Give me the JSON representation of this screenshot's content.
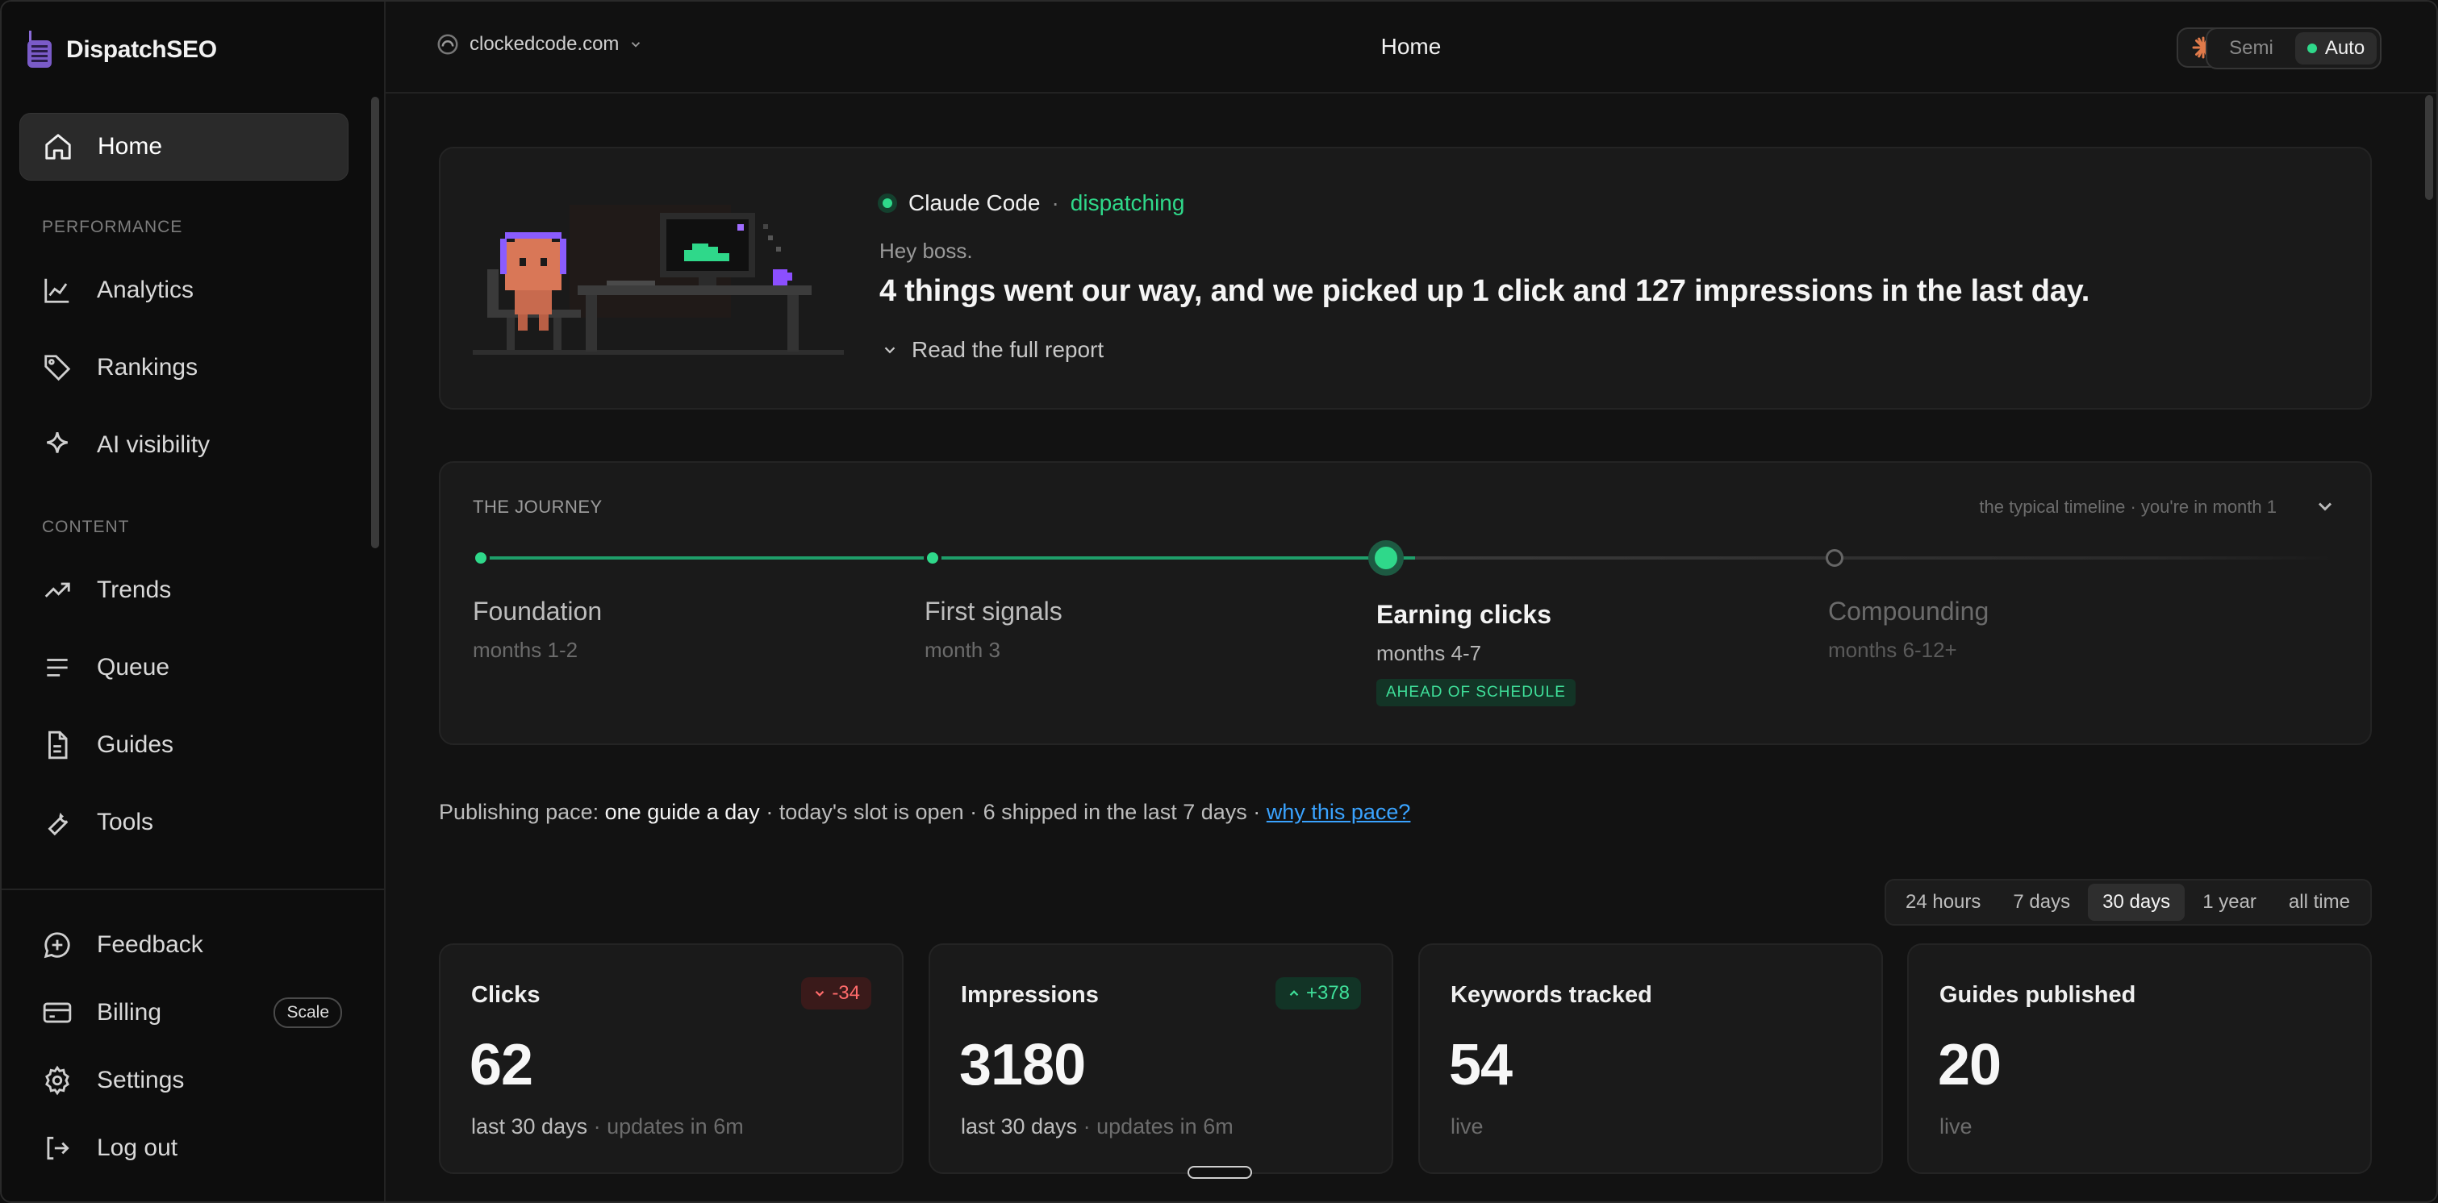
{
  "brand": {
    "name": "DispatchSEO"
  },
  "sidebar": {
    "home": "Home",
    "section_performance": "PERFORMANCE",
    "performance_items": [
      "Analytics",
      "Rankings",
      "AI visibility"
    ],
    "section_content": "CONTENT",
    "content_items": [
      "Trends",
      "Queue",
      "Guides",
      "Tools"
    ],
    "bottom_items": [
      "Feedback",
      "Billing",
      "Settings",
      "Log out"
    ],
    "billing_plan": "Scale"
  },
  "topbar": {
    "site": "clockedcode.com",
    "page_title": "Home",
    "mode_semi": "Semi",
    "mode_auto": "Auto",
    "mode_selected": "Auto"
  },
  "hero": {
    "agent": "Claude Code",
    "separator": "·",
    "status": "dispatching",
    "greeting": "Hey boss.",
    "headline": "4 things went our way, and we picked up 1 click and 127 impressions in the last day.",
    "report_link": "Read the full report"
  },
  "journey": {
    "title": "THE JOURNEY",
    "meta": "the typical timeline · you're in month 1",
    "stages": [
      {
        "name": "Foundation",
        "range": "months 1-2",
        "state": "done"
      },
      {
        "name": "First signals",
        "range": "month 3",
        "state": "done"
      },
      {
        "name": "Earning clicks",
        "range": "months 4-7",
        "state": "current",
        "badge": "AHEAD OF SCHEDULE"
      },
      {
        "name": "Compounding",
        "range": "months 6-12+",
        "state": "future"
      }
    ]
  },
  "pace": {
    "label": "Publishing pace: ",
    "value": "one guide a day",
    "rest": " · today's slot is open · 6 shipped in the last 7 days · ",
    "link": "why this pace?"
  },
  "range": {
    "options": [
      "24 hours",
      "7 days",
      "30 days",
      "1 year",
      "all time"
    ],
    "selected": "30 days"
  },
  "stats": [
    {
      "label": "Clicks",
      "value": "62",
      "delta": "-34",
      "direction": "down",
      "sub": "last 30 days",
      "sub_muted": " · updates in 6m"
    },
    {
      "label": "Impressions",
      "value": "3180",
      "delta": "+378",
      "direction": "up",
      "sub": "last 30 days",
      "sub_muted": " · updates in 6m"
    },
    {
      "label": "Keywords tracked",
      "value": "54",
      "delta": "",
      "direction": "",
      "sub": "",
      "sub_muted": "live"
    },
    {
      "label": "Guides published",
      "value": "20",
      "delta": "",
      "direction": "",
      "sub": "",
      "sub_muted": "live"
    }
  ],
  "colors": {
    "accent_green": "#2fd88a",
    "negative": "#ff6b6b",
    "link": "#3aa3ff"
  }
}
